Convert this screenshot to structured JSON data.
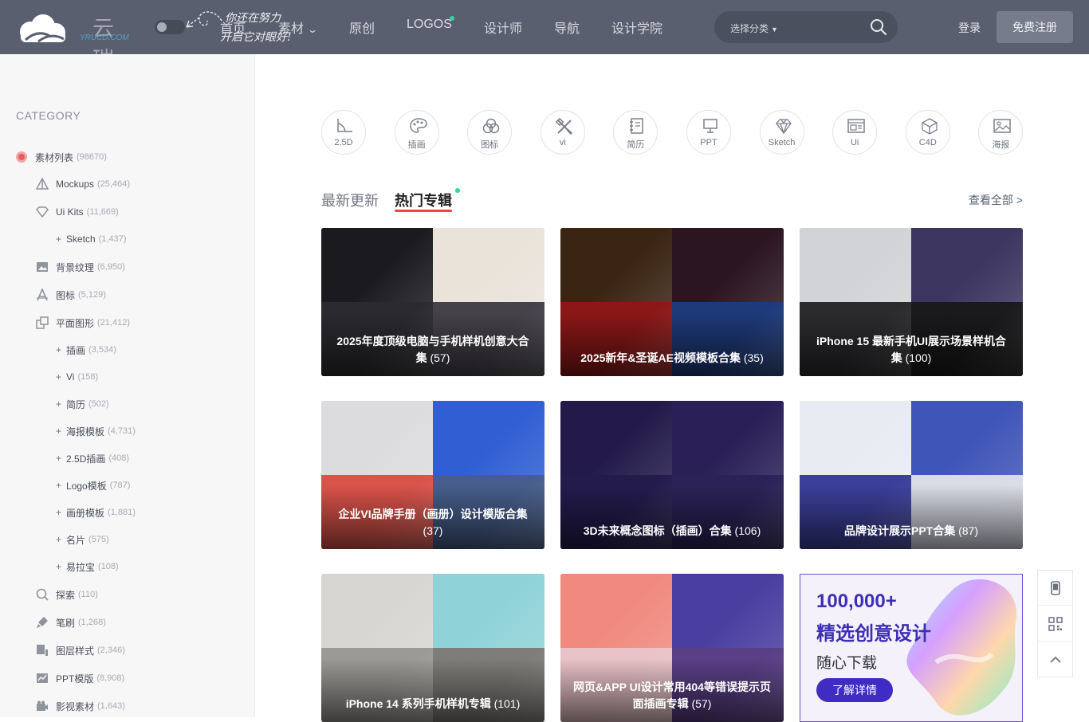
{
  "header": {
    "logo_cn": "云瑞",
    "logo_en": "YRUCD.COM",
    "hint_line1": "你还在努力",
    "hint_line2": "开启它对眼好!",
    "nav": [
      {
        "label": "首页"
      },
      {
        "label": "素材",
        "dropdown": true
      },
      {
        "label": "原创"
      },
      {
        "label": "LOGOS",
        "dot": true
      },
      {
        "label": "设计师"
      },
      {
        "label": "导航"
      },
      {
        "label": "设计学院"
      }
    ],
    "search_select": "选择分类",
    "login": "登录",
    "register": "免费注册"
  },
  "sidebar": {
    "title": "CATEGORY",
    "items": [
      {
        "label": "素材列表",
        "count": "(98670)",
        "icon": "radio-dot"
      },
      {
        "label": "Mockups",
        "count": "(25,464)",
        "icon": "mockup-icon"
      },
      {
        "label": "Ui Kits",
        "count": "(11,669)",
        "icon": "diamond-icon"
      },
      {
        "label": "Sketch",
        "count": "(1,437)",
        "sub": true
      },
      {
        "label": "背景纹理",
        "count": "(6,950)",
        "icon": "image-icon"
      },
      {
        "label": "图标",
        "count": "(5,129)",
        "icon": "font-icon"
      },
      {
        "label": "平面图形",
        "count": "(21,412)",
        "icon": "layers-icon"
      },
      {
        "label": "插画",
        "count": "(3,534)",
        "sub": true
      },
      {
        "label": "Vi",
        "count": "(158)",
        "sub": true
      },
      {
        "label": "简历",
        "count": "(502)",
        "sub": true
      },
      {
        "label": "海报模板",
        "count": "(4,731)",
        "sub": true
      },
      {
        "label": "2.5D插画",
        "count": "(408)",
        "sub": true
      },
      {
        "label": "Logo模板",
        "count": "(787)",
        "sub": true
      },
      {
        "label": "画册模板",
        "count": "(1,881)",
        "sub": true
      },
      {
        "label": "名片",
        "count": "(575)",
        "sub": true
      },
      {
        "label": "易拉宝",
        "count": "(108)",
        "sub": true
      },
      {
        "label": "探索",
        "count": "(110)",
        "icon": "search-icon"
      },
      {
        "label": "笔刷",
        "count": "(1,268)",
        "icon": "brush-icon"
      },
      {
        "label": "图层样式",
        "count": "(2,346)",
        "icon": "layer-style-icon"
      },
      {
        "label": "PPT模版",
        "count": "(8,908)",
        "icon": "chart-icon"
      },
      {
        "label": "影视素材",
        "count": "(1,643)",
        "icon": "video-icon"
      }
    ]
  },
  "types": [
    {
      "label": "2.5D",
      "icon": "axis-icon"
    },
    {
      "label": "插画",
      "icon": "palette-icon"
    },
    {
      "label": "图标",
      "icon": "circles-icon"
    },
    {
      "label": "vi",
      "icon": "tools-icon"
    },
    {
      "label": "简历",
      "icon": "notebook-icon"
    },
    {
      "label": "PPT",
      "icon": "presentation-icon"
    },
    {
      "label": "Sketch",
      "icon": "gem-icon"
    },
    {
      "label": "Ui",
      "icon": "ui-window-icon"
    },
    {
      "label": "C4D",
      "icon": "cube-icon"
    },
    {
      "label": "海报",
      "icon": "poster-icon"
    }
  ],
  "tabs": {
    "latest": "最新更新",
    "hot": "热门专辑",
    "see_all": "查看全部 >"
  },
  "cards": [
    {
      "title": "2025年度顶级电脑与手机样机创意大合集",
      "count": "(57)",
      "colors": [
        "#1b1b1f",
        "#e9e3da",
        "#2b2a30",
        "#45424a"
      ]
    },
    {
      "title": "2025新年&圣诞AE视频模板合集",
      "count": "(35)",
      "colors": [
        "#3a2412",
        "#2a1520",
        "#8c1717",
        "#1e3a7a"
      ]
    },
    {
      "title": "iPhone 15 最新手机UI展示场景样机合集",
      "count": "(100)",
      "colors": [
        "#d2d3d6",
        "#3b3560",
        "#2b2b2e",
        "#1a1a1c"
      ]
    },
    {
      "title": "企业VI品牌手册（画册）设计模版合集",
      "count": "(37)",
      "colors": [
        "#dcdcde",
        "#2f5fd3",
        "#d9534a",
        "#475e8c"
      ]
    },
    {
      "title": "3D未来概念图标（插画）合集",
      "count": "(106)",
      "colors": [
        "#231a4a",
        "#2a1f57",
        "#241b4d",
        "#2b2258"
      ]
    },
    {
      "title": "品牌设计展示PPT合集",
      "count": "(87)",
      "colors": [
        "#e8ebf2",
        "#3f55b8",
        "#3b3f9a",
        "#d9dbe6"
      ]
    },
    {
      "title": "iPhone 14 系列手机样机专辑",
      "count": "(101)",
      "colors": [
        "#d8d6d2",
        "#8fd3d8",
        "#9c9a96",
        "#7f7d79"
      ]
    },
    {
      "title": "网页&APP UI设计常用404等错误提示页面插画专辑",
      "count": "(57)",
      "colors": [
        "#f08a7e",
        "#4a3fa0",
        "#e9c3c7",
        "#5a3f86"
      ]
    }
  ],
  "ad": {
    "line1": "100,000+",
    "line2": "精选创意设计",
    "line3": "随心下载",
    "button": "了解详情"
  },
  "float_tools": [
    "tablet-icon",
    "qrcode-icon",
    "arrow-up-icon"
  ]
}
